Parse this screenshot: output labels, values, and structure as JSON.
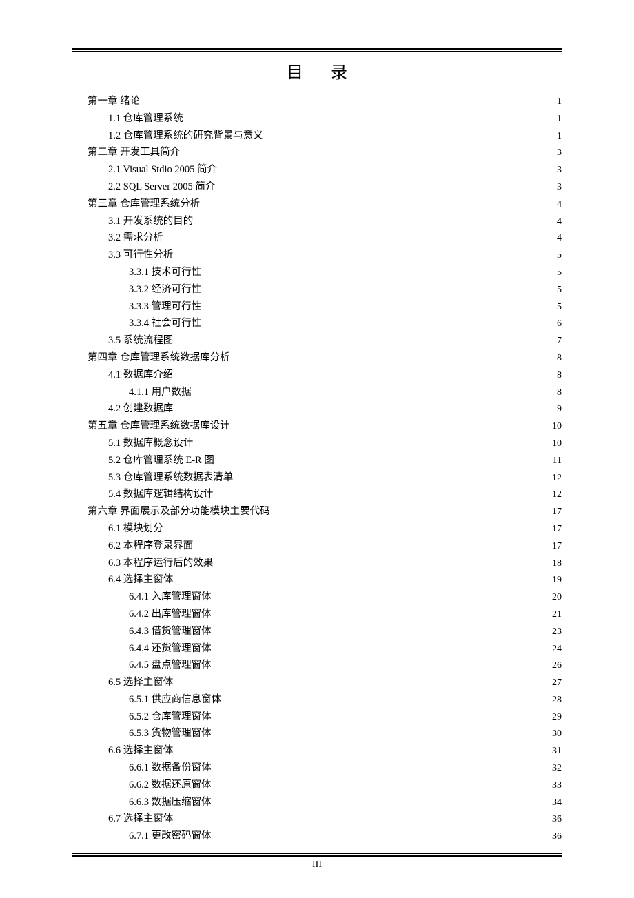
{
  "title": "目录",
  "page_number": "III",
  "toc": [
    {
      "level": 0,
      "label": "第一章  绪论",
      "page": "1"
    },
    {
      "level": 1,
      "label": "1.1  仓库管理系统",
      "page": "1"
    },
    {
      "level": 1,
      "label": "1.2  仓库管理系统的研究背景与意义",
      "page": "1"
    },
    {
      "level": 0,
      "label": "第二章  开发工具简介",
      "page": "3"
    },
    {
      "level": 1,
      "label": "2.1 Visual Stdio 2005 简介",
      "page": "3"
    },
    {
      "level": 1,
      "label": "2.2 SQL Server 2005 简介",
      "page": "3"
    },
    {
      "level": 0,
      "label": "第三章  仓库管理系统分析",
      "page": "4"
    },
    {
      "level": 1,
      "label": "3.1  开发系统的目的",
      "page": "4"
    },
    {
      "level": 1,
      "label": "3.2  需求分析",
      "page": "4"
    },
    {
      "level": 1,
      "label": "3.3  可行性分析",
      "page": "5"
    },
    {
      "level": 2,
      "label": "3.3.1  技术可行性",
      "page": "5"
    },
    {
      "level": 2,
      "label": "3.3.2  经济可行性",
      "page": "5"
    },
    {
      "level": 2,
      "label": "3.3.3  管理可行性",
      "page": "5"
    },
    {
      "level": 2,
      "label": "3.3.4  社会可行性",
      "page": "6"
    },
    {
      "level": 1,
      "label": "3.5  系统流程图",
      "page": "7"
    },
    {
      "level": 0,
      "label": "第四章  仓库管理系统数据库分析",
      "page": "8"
    },
    {
      "level": 1,
      "label": "4.1  数据库介绍",
      "page": "8"
    },
    {
      "level": 2,
      "label": "4.1.1  用户数据",
      "page": "8"
    },
    {
      "level": 1,
      "label": "4.2  创建数据库",
      "page": "9"
    },
    {
      "level": 0,
      "label": "第五章  仓库管理系统数据库设计",
      "page": "10"
    },
    {
      "level": 1,
      "label": "5.1  数据库概念设计",
      "page": "10"
    },
    {
      "level": 1,
      "label": "5.2  仓库管理系统 E-R 图",
      "page": "11"
    },
    {
      "level": 1,
      "label": "5.3  仓库管理系统数据表清单",
      "page": "12"
    },
    {
      "level": 1,
      "label": "5.4  数据库逻辑结构设计",
      "page": "12"
    },
    {
      "level": 0,
      "label": "第六章  界面展示及部分功能模块主要代码",
      "page": "17"
    },
    {
      "level": 1,
      "label": "6.1  模块划分",
      "page": "17"
    },
    {
      "level": 1,
      "label": "6.2  本程序登录界面",
      "page": "17"
    },
    {
      "level": 1,
      "label": "6.3  本程序运行后的效果",
      "page": "18"
    },
    {
      "level": 1,
      "label": "6.4  选择主窗体",
      "page": "19"
    },
    {
      "level": 2,
      "label": "6.4.1  入库管理窗体",
      "page": "20"
    },
    {
      "level": 2,
      "label": "6.4.2  出库管理窗体",
      "page": "21"
    },
    {
      "level": 2,
      "label": "6.4.3  借货管理窗体",
      "page": "23"
    },
    {
      "level": 2,
      "label": "6.4.4  还货管理窗体",
      "page": "24"
    },
    {
      "level": 2,
      "label": "6.4.5  盘点管理窗体",
      "page": "26"
    },
    {
      "level": 1,
      "label": "6.5  选择主窗体",
      "page": "27"
    },
    {
      "level": 2,
      "label": "6.5.1  供应商信息窗体",
      "page": "28"
    },
    {
      "level": 2,
      "label": "6.5.2  仓库管理窗体",
      "page": "29"
    },
    {
      "level": 2,
      "label": "6.5.3  货物管理窗体",
      "page": "30"
    },
    {
      "level": 1,
      "label": "6.6  选择主窗体",
      "page": "31"
    },
    {
      "level": 2,
      "label": "6.6.1  数据备份窗体",
      "page": "32"
    },
    {
      "level": 2,
      "label": "6.6.2  数据还原窗体",
      "page": "33"
    },
    {
      "level": 2,
      "label": "6.6.3  数据压缩窗体",
      "page": "34"
    },
    {
      "level": 1,
      "label": "6.7  选择主窗体",
      "page": "36"
    },
    {
      "level": 2,
      "label": "6.7.1  更改密码窗体",
      "page": "36"
    }
  ]
}
